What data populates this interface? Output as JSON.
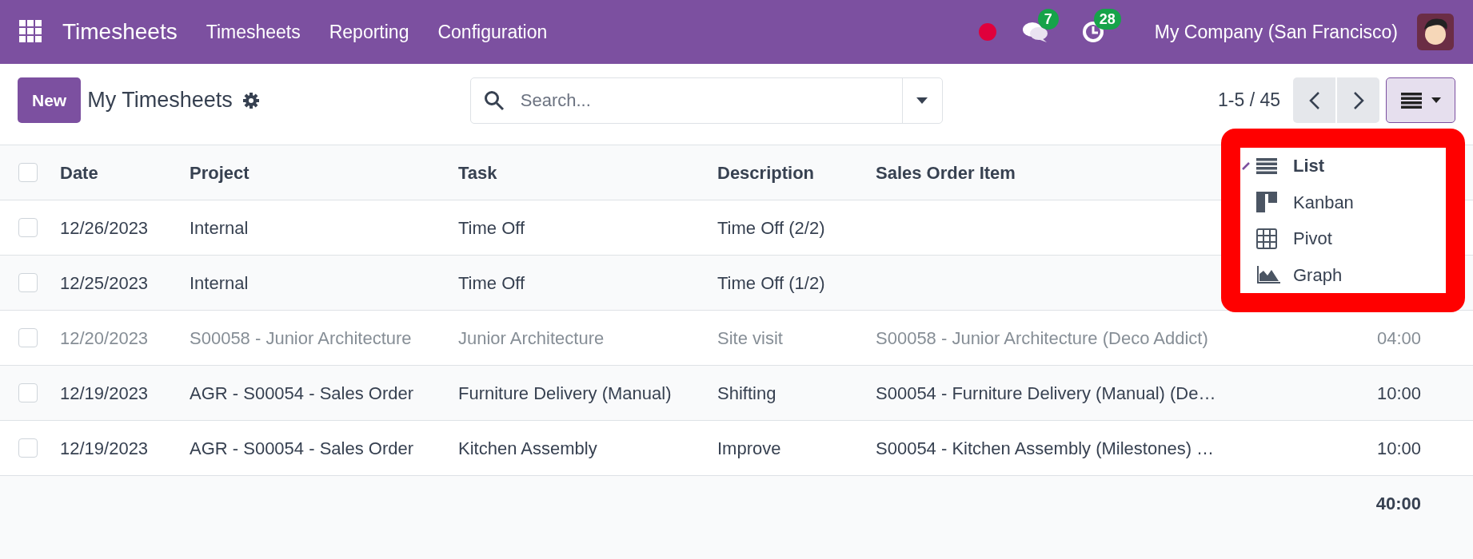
{
  "navbar": {
    "app_name": "Timesheets",
    "menu": [
      "Timesheets",
      "Reporting",
      "Configuration"
    ],
    "messages_count": "7",
    "activities_count": "28",
    "company": "My Company (San Francisco)"
  },
  "control_panel": {
    "new_button": "New",
    "title": "My Timesheets",
    "search": {
      "placeholder": "Search..."
    },
    "pager": "1-5 / 45"
  },
  "view_menu": [
    {
      "label": "List",
      "kind": "list",
      "selected": true
    },
    {
      "label": "Kanban",
      "kind": "kanban",
      "selected": false
    },
    {
      "label": "Pivot",
      "kind": "pivot",
      "selected": false
    },
    {
      "label": "Graph",
      "kind": "graph",
      "selected": false
    }
  ],
  "table": {
    "all_checked": false,
    "columns": [
      "Date",
      "Project",
      "Task",
      "Description",
      "Sales Order Item"
    ],
    "rows": [
      {
        "checked": false,
        "muted": false,
        "cells": [
          "12/26/2023",
          "Internal",
          "Time Off",
          "Time Off (2/2)",
          "",
          ""
        ]
      },
      {
        "checked": false,
        "muted": false,
        "cells": [
          "12/25/2023",
          "Internal",
          "Time Off",
          "Time Off (1/2)",
          "",
          ""
        ]
      },
      {
        "checked": false,
        "muted": true,
        "cells": [
          "12/20/2023",
          "S00058 - Junior Architecture",
          "Junior Architecture",
          "Site visit",
          "S00058 - Junior Architecture (Deco Addict)",
          "04:00"
        ]
      },
      {
        "checked": false,
        "muted": false,
        "cells": [
          "12/19/2023",
          "AGR - S00054 - Sales Order",
          "Furniture Delivery (Manual)",
          "Shifting",
          "S00054 - Furniture Delivery (Manual) (De…",
          "10:00"
        ]
      },
      {
        "checked": false,
        "muted": false,
        "cells": [
          "12/19/2023",
          "AGR - S00054 - Sales Order",
          "Kitchen Assembly",
          "Improve",
          "S00054 - Kitchen Assembly (Milestones) …",
          "10:00"
        ]
      }
    ],
    "total": "40:00"
  }
}
